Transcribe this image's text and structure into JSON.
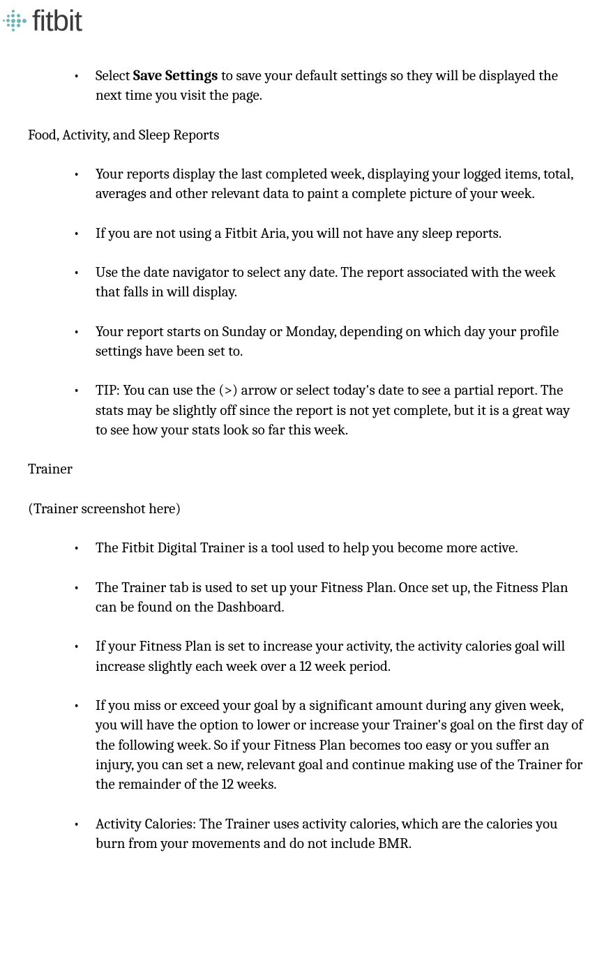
{
  "logo": {
    "text": "fitbit"
  },
  "intro_bullet": {
    "prefix": "Select ",
    "bold": "Save Settings",
    "suffix": " to save your default settings so they will be displayed the next time you visit the page."
  },
  "section1": {
    "heading": "Food, Activity, and Sleep Reports",
    "bullets": [
      "Your reports display the last completed week, displaying your logged items, total, averages and other relevant data to paint a complete picture of your week.",
      "If you are not using a Fitbit Aria, you will not have any sleep reports.",
      "Use the date navigator to select any date. The report associated with the week that falls in will display.",
      "Your report starts on Sunday or Monday, depending on which day your profile settings have been set to.",
      "TIP: You can use the (>) arrow or select today's date to see a partial report. The stats may be slightly off since the report is not yet complete, but it is a great way to see how your stats look so far this week."
    ]
  },
  "section2": {
    "heading": "Trainer",
    "subtext": "(Trainer screenshot here)",
    "bullets": [
      "The Fitbit Digital Trainer is a tool used to help you become more active.",
      "The Trainer tab is used to set up your Fitness Plan. Once set up, the Fitness Plan can be found on the Dashboard.",
      "If your Fitness Plan is set to increase your activity, the activity calories goal will increase slightly each week over a 12 week period.",
      "If you miss or exceed your goal by a significant amount during any given week, you will have the option to lower or increase your Trainer's goal on the first day of the following week. So if your Fitness Plan becomes too easy or you suffer an injury, you can set a new, relevant goal and continue making use of the Trainer for the remainder of the 12 weeks.",
      "Activity Calories: The Trainer uses activity calories, which are the calories you burn from your movements and do not include BMR."
    ]
  }
}
